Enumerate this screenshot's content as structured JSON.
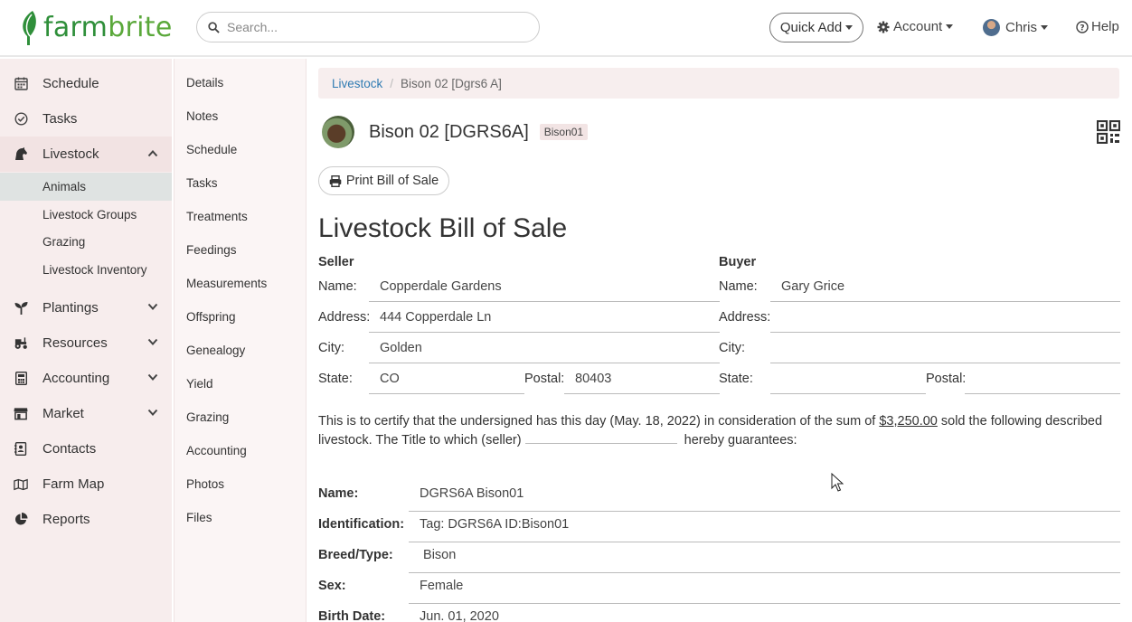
{
  "brand": {
    "name_part1": "farm",
    "name_part2": "brite",
    "green": "#2f8f3a",
    "leaf_color": "#5aa83a"
  },
  "header": {
    "search_placeholder": "Search...",
    "quick_add": "Quick Add",
    "account": "Account",
    "user": "Chris",
    "help": "Help"
  },
  "sidebar": {
    "items": [
      {
        "label": "Schedule",
        "icon": "calendar-icon"
      },
      {
        "label": "Tasks",
        "icon": "check-circle-icon"
      },
      {
        "label": "Livestock",
        "icon": "horse-icon"
      },
      {
        "label": "Plantings",
        "icon": "seedling-icon"
      },
      {
        "label": "Resources",
        "icon": "tractor-icon"
      },
      {
        "label": "Accounting",
        "icon": "calculator-icon"
      },
      {
        "label": "Market",
        "icon": "store-icon"
      },
      {
        "label": "Contacts",
        "icon": "address-book-icon"
      },
      {
        "label": "Farm Map",
        "icon": "map-icon"
      },
      {
        "label": "Reports",
        "icon": "pie-chart-icon"
      }
    ],
    "livestock_sub": [
      "Animals",
      "Livestock Groups",
      "Grazing",
      "Livestock Inventory"
    ]
  },
  "subnav": [
    "Details",
    "Notes",
    "Schedule",
    "Tasks",
    "Treatments",
    "Feedings",
    "Measurements",
    "Offspring",
    "Genealogy",
    "Yield",
    "Grazing",
    "Accounting",
    "Photos",
    "Files"
  ],
  "breadcrumb": {
    "parent": "Livestock",
    "current": "Bison 02 [Dgrs6 A]"
  },
  "animal": {
    "name": "Bison 02 [DGRS6A]",
    "tag": "Bison01"
  },
  "print_button": "Print Bill of Sale",
  "document": {
    "title": "Livestock Bill of Sale",
    "seller": {
      "heading": "Seller",
      "name_label": "Name:",
      "name": "Copperdale Gardens",
      "address_label": "Address:",
      "address": "444 Copperdale Ln",
      "city_label": "City:",
      "city": "Golden",
      "state_label": "State:",
      "state": "CO",
      "postal_label": "Postal:",
      "postal": "80403"
    },
    "buyer": {
      "heading": "Buyer",
      "name_label": "Name:",
      "name": "Gary Grice",
      "address_label": "Address:",
      "address": "",
      "city_label": "City:",
      "city": "",
      "state_label": "State:",
      "state": "",
      "postal_label": "Postal:",
      "postal": ""
    },
    "certify_part1": "This is to certify that the undersigned has this day (May. 18, 2022) in consideration of the sum of",
    "amount": "$3,250.00",
    "certify_part2": "sold the following described livestock. The Title to which (seller)",
    "certify_part3": "hereby guarantees:",
    "details": [
      {
        "label": "Name:",
        "value": "DGRS6A Bison01"
      },
      {
        "label": "Identification:",
        "value": "Tag: DGRS6A ID:Bison01"
      },
      {
        "label": "Breed/Type:",
        "value": " Bison"
      },
      {
        "label": "Sex:",
        "value": "Female"
      },
      {
        "label": "Birth Date:",
        "value": "Jun. 01, 2020"
      }
    ]
  }
}
